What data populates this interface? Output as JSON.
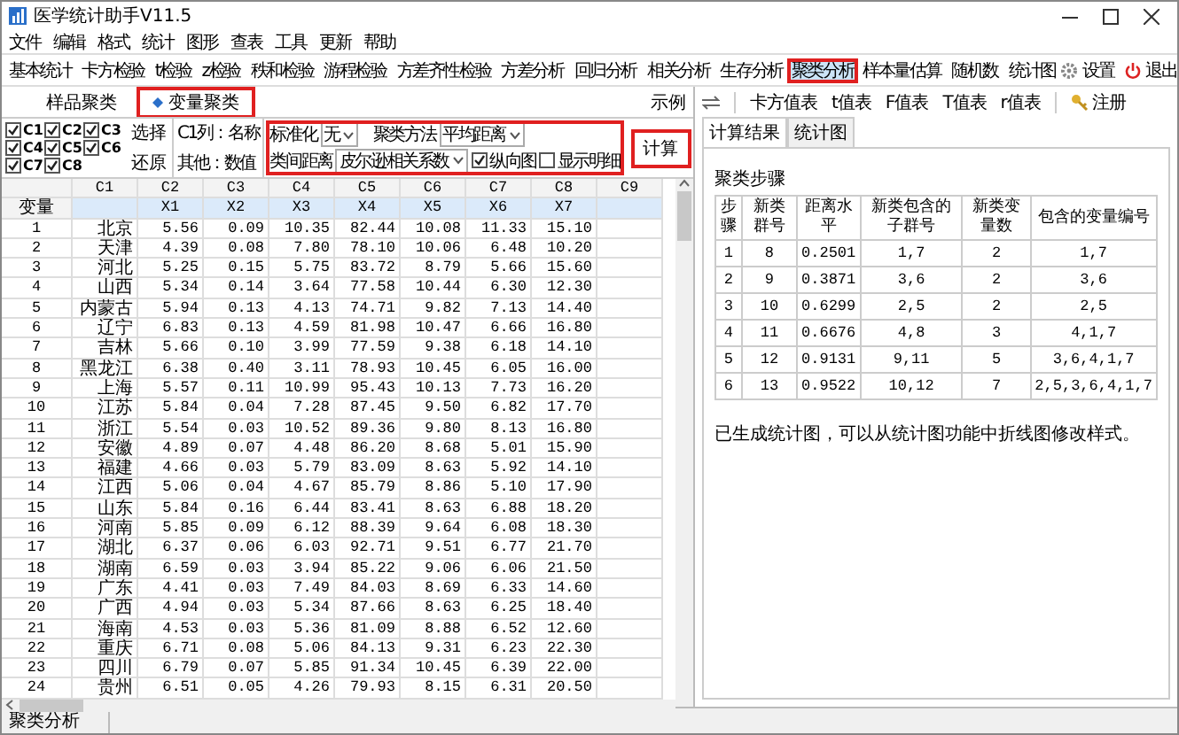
{
  "window": {
    "title": "医学统计助手V11.5"
  },
  "menu": [
    "文件",
    "编辑",
    "格式",
    "统计",
    "图形",
    "查表",
    "工具",
    "更新",
    "帮助"
  ],
  "toolbar": [
    {
      "label": "基本统计",
      "selected": false,
      "highlighted": false
    },
    {
      "label": "卡方检验",
      "selected": false,
      "highlighted": false
    },
    {
      "label": "t检验",
      "selected": false,
      "highlighted": false
    },
    {
      "label": "z检验",
      "selected": false,
      "highlighted": false
    },
    {
      "label": "秩和检验",
      "selected": false,
      "highlighted": false
    },
    {
      "label": "游程检验",
      "selected": false,
      "highlighted": false
    },
    {
      "label": "方差齐性检验",
      "selected": false,
      "highlighted": false
    },
    {
      "label": "方差分析",
      "selected": false,
      "highlighted": false
    },
    {
      "label": "回归分析",
      "selected": false,
      "highlighted": false
    },
    {
      "label": "相关分析",
      "selected": false,
      "highlighted": false
    },
    {
      "label": "生存分析",
      "selected": false,
      "highlighted": false
    },
    {
      "label": "聚类分析",
      "selected": true,
      "highlighted": true
    },
    {
      "label": "样本量估算",
      "selected": false,
      "highlighted": false
    },
    {
      "label": "随机数",
      "selected": false,
      "highlighted": false
    },
    {
      "label": "统计图",
      "selected": false,
      "highlighted": false
    }
  ],
  "toolbar_right": {
    "settings": "设置",
    "exit": "退出"
  },
  "mode_tabs": [
    {
      "label": "样品聚类",
      "selected": false,
      "highlighted": false
    },
    {
      "label": "变量聚类",
      "selected": true,
      "highlighted": true
    }
  ],
  "example_label": "示例",
  "options": {
    "variables": [
      {
        "label": "C1",
        "checked": true
      },
      {
        "label": "C2",
        "checked": true
      },
      {
        "label": "C3",
        "checked": true
      },
      {
        "label": "C4",
        "checked": true
      },
      {
        "label": "C5",
        "checked": true
      },
      {
        "label": "C6",
        "checked": true
      },
      {
        "label": "C7",
        "checked": true
      },
      {
        "label": "C8",
        "checked": true
      }
    ],
    "select_button": "选择",
    "restore_button": "还原",
    "c1_note": "C1列：名称",
    "other_note": "其他：数值",
    "highlighted": true,
    "standardize": {
      "label": "标准化",
      "value": "无"
    },
    "method": {
      "label": "聚类方法",
      "value": "平均距离"
    },
    "distance": {
      "label": "类间距离",
      "value": "皮尔逊相关系数"
    },
    "vertical_plot": {
      "label": "纵向图",
      "checked": true
    },
    "show_detail": {
      "label": "显示明细",
      "checked": false
    }
  },
  "compute_button": {
    "label": "计算",
    "highlighted": true
  },
  "grid": {
    "columns": [
      "C1",
      "C2",
      "C3",
      "C4",
      "C5",
      "C6",
      "C7",
      "C8",
      "C9"
    ],
    "label_row": {
      "header": "变量",
      "labels": [
        "X1",
        "X2",
        "X3",
        "X4",
        "X5",
        "X6",
        "X7"
      ]
    },
    "rows": [
      {
        "number": "1",
        "cells": [
          "北京",
          "5.56",
          "0.09",
          "10.35",
          "82.44",
          "10.08",
          "11.33",
          "15.10"
        ]
      },
      {
        "number": "2",
        "cells": [
          "天津",
          "4.39",
          "0.08",
          "7.80",
          "78.10",
          "10.06",
          "6.48",
          "10.20"
        ]
      },
      {
        "number": "3",
        "cells": [
          "河北",
          "5.25",
          "0.15",
          "5.75",
          "83.72",
          "8.79",
          "5.66",
          "15.60"
        ]
      },
      {
        "number": "4",
        "cells": [
          "山西",
          "5.34",
          "0.14",
          "3.64",
          "77.58",
          "10.44",
          "6.30",
          "12.30"
        ]
      },
      {
        "number": "5",
        "cells": [
          "内蒙古",
          "5.94",
          "0.13",
          "4.13",
          "74.71",
          "9.82",
          "7.13",
          "14.40"
        ]
      },
      {
        "number": "6",
        "cells": [
          "辽宁",
          "6.83",
          "0.13",
          "4.59",
          "81.98",
          "10.47",
          "6.66",
          "16.80"
        ]
      },
      {
        "number": "7",
        "cells": [
          "吉林",
          "5.66",
          "0.10",
          "3.99",
          "77.59",
          "9.38",
          "6.18",
          "14.10"
        ]
      },
      {
        "number": "8",
        "cells": [
          "黑龙江",
          "6.38",
          "0.40",
          "3.11",
          "78.93",
          "10.45",
          "6.05",
          "16.00"
        ]
      },
      {
        "number": "9",
        "cells": [
          "上海",
          "5.57",
          "0.11",
          "10.99",
          "95.43",
          "10.13",
          "7.73",
          "16.20"
        ]
      },
      {
        "number": "10",
        "cells": [
          "江苏",
          "5.84",
          "0.04",
          "7.28",
          "87.45",
          "9.50",
          "6.82",
          "17.70"
        ]
      },
      {
        "number": "11",
        "cells": [
          "浙江",
          "5.54",
          "0.03",
          "10.52",
          "89.36",
          "9.80",
          "8.13",
          "16.80"
        ]
      },
      {
        "number": "12",
        "cells": [
          "安徽",
          "4.89",
          "0.07",
          "4.48",
          "86.20",
          "8.68",
          "5.01",
          "15.90"
        ]
      },
      {
        "number": "13",
        "cells": [
          "福建",
          "4.66",
          "0.03",
          "5.79",
          "83.09",
          "8.63",
          "5.92",
          "14.10"
        ]
      },
      {
        "number": "14",
        "cells": [
          "江西",
          "5.06",
          "0.04",
          "4.67",
          "85.79",
          "8.86",
          "5.10",
          "17.90"
        ]
      },
      {
        "number": "15",
        "cells": [
          "山东",
          "5.84",
          "0.16",
          "6.44",
          "83.41",
          "8.63",
          "6.88",
          "18.20"
        ]
      },
      {
        "number": "16",
        "cells": [
          "河南",
          "5.85",
          "0.09",
          "6.12",
          "88.39",
          "9.64",
          "6.08",
          "18.30"
        ]
      },
      {
        "number": "17",
        "cells": [
          "湖北",
          "6.37",
          "0.06",
          "6.03",
          "92.71",
          "9.51",
          "6.77",
          "21.70"
        ]
      },
      {
        "number": "18",
        "cells": [
          "湖南",
          "6.59",
          "0.03",
          "3.94",
          "85.22",
          "9.06",
          "6.06",
          "21.50"
        ]
      },
      {
        "number": "19",
        "cells": [
          "广东",
          "4.41",
          "0.03",
          "7.49",
          "84.03",
          "8.69",
          "6.33",
          "14.60"
        ]
      },
      {
        "number": "20",
        "cells": [
          "广西",
          "4.94",
          "0.03",
          "5.34",
          "87.66",
          "8.63",
          "6.25",
          "18.40"
        ]
      },
      {
        "number": "21",
        "cells": [
          "海南",
          "4.53",
          "0.03",
          "5.36",
          "81.09",
          "8.88",
          "6.52",
          "12.60"
        ]
      },
      {
        "number": "22",
        "cells": [
          "重庆",
          "6.71",
          "0.08",
          "5.06",
          "84.13",
          "9.31",
          "6.23",
          "22.30"
        ]
      },
      {
        "number": "23",
        "cells": [
          "四川",
          "6.79",
          "0.07",
          "5.85",
          "91.34",
          "10.45",
          "6.39",
          "22.00"
        ]
      },
      {
        "number": "24",
        "cells": [
          "贵州",
          "6.51",
          "0.05",
          "4.26",
          "79.93",
          "8.15",
          "6.31",
          "20.50"
        ]
      }
    ]
  },
  "table_tools": [
    "卡方值表",
    "t值表",
    "F值表",
    "T值表",
    "r值表"
  ],
  "register": "注册",
  "result_tabs": [
    {
      "label": "计算结果",
      "selected": true
    },
    {
      "label": "统计图",
      "selected": false
    }
  ],
  "steps": {
    "title": "聚类步骤",
    "columns": [
      "步骤",
      "新类群号",
      "距离水平",
      "新类包含的子群号",
      "新类变量数",
      "包含的变量编号"
    ],
    "rows": [
      [
        "1",
        "8",
        "0.2501",
        "1,7",
        "2",
        "1,7"
      ],
      [
        "2",
        "9",
        "0.3871",
        "3,6",
        "2",
        "3,6"
      ],
      [
        "3",
        "10",
        "0.6299",
        "2,5",
        "2",
        "2,5"
      ],
      [
        "4",
        "11",
        "0.6676",
        "4,8",
        "3",
        "4,1,7"
      ],
      [
        "5",
        "12",
        "0.9131",
        "9,11",
        "5",
        "3,6,4,1,7"
      ],
      [
        "6",
        "13",
        "0.9522",
        "10,12",
        "7",
        "2,5,3,6,4,1,7"
      ]
    ]
  },
  "note": "已生成统计图，可以从统计图功能中折线图修改样式。",
  "status_bar": "聚类分析"
}
